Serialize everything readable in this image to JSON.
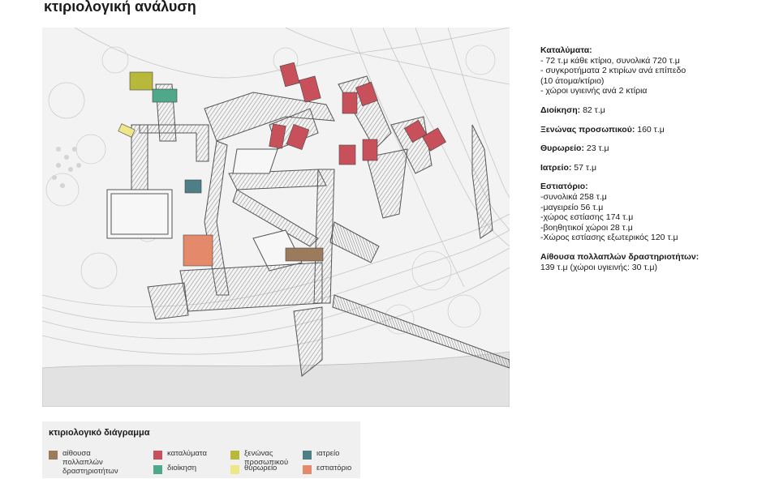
{
  "title": "κτιριολογική ανάλυση",
  "info": [
    {
      "title": "Καταλύματα:",
      "title_only": true,
      "lines": [
        "- 72 τ.μ κάθε κτίριο, συνολικά 720 τ.μ",
        "- συγκροτήματα 2 κτιρίων ανά επίπεδο",
        "(10 άτομα/κτίριο)",
        "- χώροι υγιεινής ανά 2 κτίρια"
      ]
    },
    {
      "title": "Διοίκηση:",
      "value": " 82 τ.μ",
      "lines": []
    },
    {
      "title": "Ξενώνας προσωπικού:",
      "value": " 160 τ.μ",
      "lines": []
    },
    {
      "title": "Θυρωρείο:",
      "value": " 23 τ.μ",
      "lines": []
    },
    {
      "title": "Ιατρείο:",
      "value": " 57 τ.μ",
      "lines": []
    },
    {
      "title": "Εστιατόριο:",
      "value": "",
      "lines": [
        "-συνολικά 258 τ.μ",
        "-μαγειρείο 56 τ.μ",
        "-χώρος εστίασης 174 τ.μ",
        "-βοηθητικοί χώροι 28 τ.μ",
        "-Χώρος εστίασης εξωτερικός 120 τ.μ"
      ]
    },
    {
      "title": "Αίθουσα πολλαπλών δραστηριοτήτων:",
      "value": "",
      "lines": [
        "139 τ.μ (χώροι υγιεινής: 30 τ.μ)"
      ]
    }
  ],
  "legend": {
    "title": "κτιριολογικό διάγραμμα",
    "items": [
      {
        "label": "αίθουσα πολλαπλών\nδραστηριοτήτων",
        "color": "#9b7b5b"
      },
      {
        "label": "καταλύματα",
        "color": "#c8505a"
      },
      {
        "label": "διοίκηση",
        "color": "#4fa88a"
      },
      {
        "label": "ξενώνας\nπροσωπικού",
        "color": "#b8b83a"
      },
      {
        "label": "θυρωρείο",
        "color": "#efe68a"
      },
      {
        "label": "ιατρείο",
        "color": "#4f7f86"
      },
      {
        "label": "εστιατόριο",
        "color": "#e48a6a"
      }
    ]
  },
  "plan_colors": {
    "multipurpose": "#9b7b5b",
    "lodging": "#c8505a",
    "admin": "#4fa88a",
    "staff": "#b8b83a",
    "porter": "#efe68a",
    "clinic": "#4f7f86",
    "restaurant": "#e48a6a"
  }
}
